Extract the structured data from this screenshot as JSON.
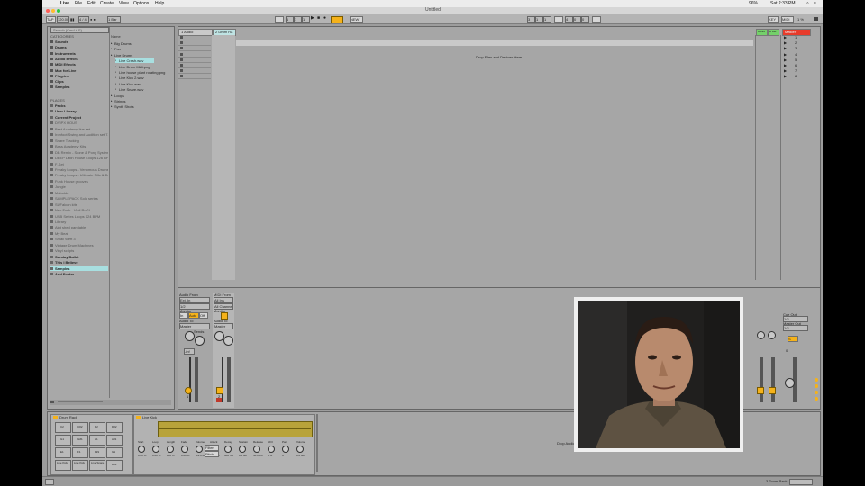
{
  "menubar": {
    "apple_glyph": "",
    "app": "Live",
    "items": [
      "File",
      "Edit",
      "Create",
      "View",
      "Options",
      "Help"
    ],
    "battery": "96%",
    "clock": "Sat 2:33 PM"
  },
  "titlebar": {
    "title": "Untitled"
  },
  "controlbar": {
    "tap": "TAP",
    "tempo": "120.00",
    "meter": "4 / 4",
    "quant": "1 Bar",
    "pos1": "1",
    "pos2": "1",
    "pos3": "1",
    "new_label": "NEW",
    "loop_start1": "3",
    "loop_start2": "1",
    "loop_start3": "1",
    "loop_len1": "4",
    "loop_len2": "0",
    "loop_len3": "0",
    "key": "KEY",
    "midi": "MIDI",
    "cpu": "1 %"
  },
  "browser": {
    "search_placeholder": "Search (Cmd + F)",
    "categories_header": "CATEGORIES",
    "categories": [
      "Sounds",
      "Drums",
      "Instruments",
      "Audio Effects",
      "MIDI Effects",
      "Max for Live",
      "Plug-ins",
      "Clips",
      "Samples"
    ],
    "places_header": "PLACES",
    "places": [
      "Packs",
      "User Library",
      "Current Project",
      "DVIPX HOUS",
      "Best Academy live set",
      "Ironfoot Swing and Audition set 7-4-1 A",
      "Snare Tracking",
      "Bass Academy Kits",
      "DB Remix - Stone & Pony System",
      "DEEP Latin House Loops 126 BPM",
      "F-Set",
      "Freaky Loops - Venomous Drums",
      "Freaky Loops - Ultimate Fills & Drops",
      "Funk House grooves",
      "Jungle",
      "Moloddo",
      "SAMPLEPACK Solo series",
      "SUFalcon kits",
      "Neo Funk - Vinil RoGI",
      "USB Series Loops 124 BPM",
      "Library",
      "Aint shed pandable",
      "My Beat",
      "Small Weft 3",
      "Vintage Drum Machines",
      "Vinyl scripts",
      "Sunday Ballet",
      "This I Believe",
      "Samples",
      "Add Folder..."
    ],
    "name_header": "Name",
    "files": [
      "Big Drums",
      "Fun",
      "Live Drums",
      "Live Crash.wav",
      "Live Drum Midi.png",
      "Live house plant rotating.png",
      "Live Kick 2.wav",
      "Live Kick.wav",
      "Live Snare.wav",
      "Loops",
      "Strings",
      "Synth Shots"
    ]
  },
  "session": {
    "tracks": [
      {
        "name": "1 Audio"
      },
      {
        "name": "2 Drum Ra"
      }
    ],
    "returns": [
      {
        "name": "A Rev"
      },
      {
        "name": "B Del"
      }
    ],
    "master": {
      "name": "Master"
    },
    "scene_numbers": [
      "1",
      "2",
      "3",
      "4",
      "5",
      "6",
      "7",
      "8"
    ],
    "drop_files_text": "Drop Files and Devices Here",
    "audio_from": "Audio From",
    "ext_in": "Ext. In",
    "midi_from": "MIDI From",
    "all_ins": "All Ins",
    "all_channels": "All Channels",
    "monitor": "Monitor",
    "in_label": "In",
    "auto_label": "Auto",
    "off_label": "Off",
    "audio_to": "Audio To",
    "master_out": "Master",
    "sends": "Sends",
    "cue_out": "Cue Out",
    "master_out_label": "Master Out",
    "io_value": "1/2",
    "track1_num": "1",
    "track2_num": "2",
    "volume_readout": "-inf",
    "master_vol": "0",
    "solo": "S"
  },
  "detail": {
    "device1_title": "Drum Rack",
    "pads": [
      "C2",
      "C#2",
      "D2",
      "D#2",
      "G1",
      "G#1",
      "A1",
      "A#1",
      "E1",
      "F1",
      "F#1",
      "G1",
      "C1",
      "C#1",
      "D1",
      "D#1"
    ],
    "pad_named": [
      "Live Kick",
      "Live Kick",
      "Live Snare"
    ],
    "device2_title": "Live Kick",
    "sampler_labels": [
      "Start",
      "Loop",
      "Length",
      "Fade",
      "Volume",
      "Attack",
      "Decay",
      "Sustain",
      "Release",
      "LFO",
      "Pan",
      "Volume"
    ],
    "sampler_values": [
      "0.00 %",
      "0.00 %",
      "100 %",
      "0.00 %",
      "-12.0 dB",
      "0.00 ms",
      "600 ms",
      "0.0 dB",
      "50.0 ms",
      "0 %",
      "C",
      "0.0 dB"
    ],
    "filter_label": "Filter",
    "pitch_label": "Pitch",
    "live_crash": "Live Crash",
    "drop_text": "Drop Audio Effects Here"
  },
  "statusbar": {
    "right_label": "3-Drum Rack"
  },
  "colors": {
    "selection": "#a8dfe0",
    "return_a": "#74d06a",
    "return_b": "#74d06a",
    "master_header": "#e83b2b",
    "accent_yellow": "#f5b21a",
    "waveform": "#b8a33a"
  }
}
